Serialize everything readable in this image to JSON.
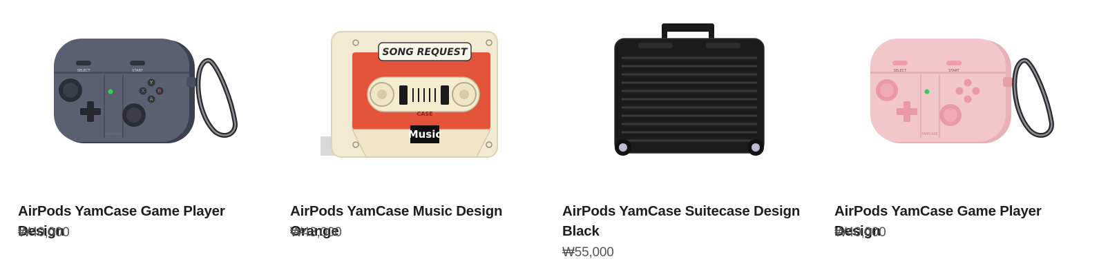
{
  "products": [
    {
      "name": "AirPods YamCase Game Player Design",
      "price": "₩40,000",
      "image": {
        "icon": "gamepad-airpods-case",
        "body_color": "#5a6070",
        "labels": {
          "select": "SELECT",
          "start": "START",
          "brand": "YAMCASE"
        }
      }
    },
    {
      "name": "AirPods YamCase Music Design Orange",
      "price": "₩43,000",
      "image": {
        "icon": "cassette-airpods-case",
        "body_color": "#f2ead2",
        "accent_color": "#e4543a",
        "labels": {
          "sticker": "SONG REQUEST",
          "brand": "CASE",
          "tag": "Music"
        }
      }
    },
    {
      "name": "AirPods YamCase Suitecase Design Black",
      "price": "₩55,000",
      "image": {
        "icon": "suitcase-airpods-case",
        "body_color": "#1b1b1b"
      }
    },
    {
      "name": "AirPods YamCase Game Player Design",
      "price": "₩40,000",
      "image": {
        "icon": "gamepad-airpods-case",
        "body_color": "#f2c7cc",
        "labels": {
          "select": "SELECT",
          "start": "START",
          "brand": "YAMCASE"
        }
      }
    }
  ]
}
